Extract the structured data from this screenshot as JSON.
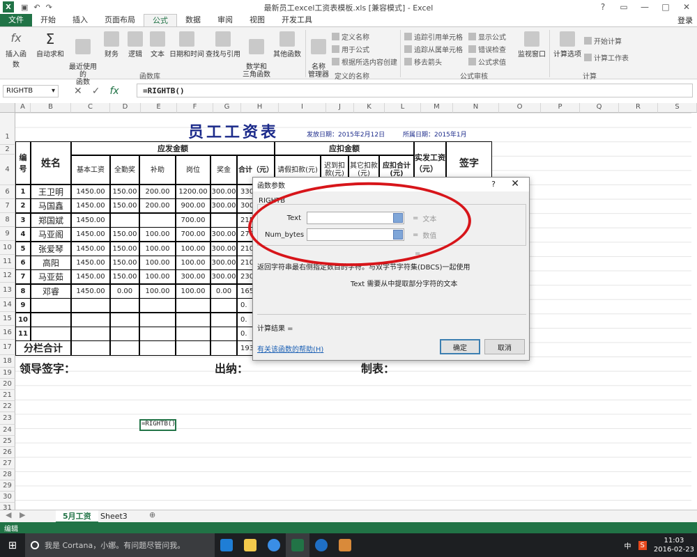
{
  "window": {
    "title": "最新员工excel工资表模板.xls  [兼容模式] - Excel",
    "controls": [
      "?",
      "▭",
      "—",
      "□",
      "✕"
    ]
  },
  "ribbon": {
    "tabs": [
      "文件",
      "开始",
      "插入",
      "页面布局",
      "公式",
      "数据",
      "审阅",
      "视图",
      "开发工具"
    ],
    "active_tab": "公式",
    "login": "登录",
    "buttons": {
      "insert_fn": "插入函数",
      "autosum": "自动求和",
      "recent": "最近使用的\n函数",
      "finance": "财务",
      "logic": "逻辑",
      "text": "文本",
      "datetime": "日期和时间",
      "lookup": "查找与引用",
      "math": "数学和\n三角函数",
      "other": "其他函数",
      "name_mgr": "名称\n管理器",
      "define_name": "定义名称",
      "use_in_formula": "用于公式",
      "create_from_sel": "根据所选内容创建",
      "trace_prec": "追踪引用单元格",
      "trace_dep": "追踪从属单元格",
      "remove_arrows": "移去箭头",
      "show_formulas": "显示公式",
      "error_check": "错误检查",
      "eval_formula": "公式求值",
      "watch": "监视窗口",
      "calc_options": "计算选项",
      "calc_now": "开始计算",
      "calc_sheet": "计算工作表"
    },
    "groups": [
      "函数库",
      "定义的名称",
      "公式审核",
      "计算"
    ]
  },
  "formula_bar": {
    "name_box": "RIGHTB",
    "formula": "=RIGHTB()"
  },
  "columns": [
    "A",
    "B",
    "C",
    "D",
    "E",
    "F",
    "G",
    "H",
    "I",
    "J",
    "K",
    "L",
    "M",
    "N",
    "O",
    "P",
    "Q",
    "R",
    "S"
  ],
  "rows": [
    "1",
    "2",
    "4",
    "6",
    "7",
    "8",
    "9",
    "10",
    "11",
    "12",
    "13",
    "14",
    "15",
    "16",
    "17",
    "18",
    "19",
    "20",
    "21",
    "22",
    "23",
    "24",
    "25",
    "26",
    "27",
    "28",
    "29",
    "30",
    "31"
  ],
  "sheet": {
    "title": "员工工资表",
    "issue_date": "发放日期：2015年2月12日",
    "period": "所属日期：2015年1月",
    "headers": {
      "no": "编\n号",
      "name": "姓名",
      "payable": "应发金额",
      "deduct": "应扣金额",
      "net": "实发工资\n（元）",
      "sign": "签字",
      "base": "基本工资",
      "attendance": "全勤奖",
      "subsidy": "补助",
      "position": "岗位",
      "bonus": "奖金",
      "total": "合计（元）",
      "leave": "请假扣款(元)",
      "late": "迟到扣\n款(元)",
      "other": "其它扣款\n(元)",
      "deduct_total": "应扣合计\n(元)"
    },
    "employees": [
      {
        "no": "1",
        "name": "王卫明",
        "base": "1450.00",
        "att": "150.00",
        "sub": "200.00",
        "pos": "1200.00",
        "bonus": "300.00",
        "total": "330"
      },
      {
        "no": "2",
        "name": "马国鑫",
        "base": "1450.00",
        "att": "150.00",
        "sub": "200.00",
        "pos": "900.00",
        "bonus": "300.00",
        "total": "300"
      },
      {
        "no": "3",
        "name": "郑国斌",
        "base": "1450.00",
        "att": "",
        "sub": "",
        "pos": "700.00",
        "bonus": "",
        "total": "215"
      },
      {
        "no": "4",
        "name": "马亚阁",
        "base": "1450.00",
        "att": "150.00",
        "sub": "100.00",
        "pos": "700.00",
        "bonus": "300.00",
        "total": "270"
      },
      {
        "no": "5",
        "name": "张爱琴",
        "base": "1450.00",
        "att": "150.00",
        "sub": "100.00",
        "pos": "100.00",
        "bonus": "300.00",
        "total": "210"
      },
      {
        "no": "6",
        "name": "高阳",
        "base": "1450.00",
        "att": "150.00",
        "sub": "100.00",
        "pos": "100.00",
        "bonus": "300.00",
        "total": "210"
      },
      {
        "no": "7",
        "name": "马亚茹",
        "base": "1450.00",
        "att": "150.00",
        "sub": "100.00",
        "pos": "300.00",
        "bonus": "300.00",
        "total": "230"
      },
      {
        "no": "8",
        "name": "邓睿",
        "base": "1450.00",
        "att": "0.00",
        "sub": "100.00",
        "pos": "100.00",
        "bonus": "0.00",
        "total": "165"
      },
      {
        "no": "9",
        "name": "",
        "base": "",
        "att": "",
        "sub": "",
        "pos": "",
        "bonus": "",
        "total": "0."
      },
      {
        "no": "10",
        "name": "",
        "base": "",
        "att": "",
        "sub": "",
        "pos": "",
        "bonus": "",
        "total": "0."
      },
      {
        "no": "11",
        "name": "",
        "base": "",
        "att": "",
        "sub": "",
        "pos": "",
        "bonus": "",
        "total": "0."
      }
    ],
    "subtotal_label": "分栏合计",
    "subtotal_value": "1930",
    "sig_leader": "领导签字：",
    "sig_cashier": "出纳：",
    "sig_maker": "制表：",
    "active_cell_text": "=RIGHTB()"
  },
  "dialog": {
    "title": "函数参数",
    "help_q": "?",
    "close": "✕",
    "function_name": "RIGHTB",
    "args": [
      {
        "label": "Text",
        "value": "文本"
      },
      {
        "label": "Num_bytes",
        "value": "数值"
      }
    ],
    "eq": "=",
    "description": "返回字符串最右侧指定数目的字符。与双字节字符集(DBCS)一起使用",
    "arg_desc": "Text  需要从中提取部分字符的文本",
    "result": "计算结果 =",
    "help_link": "有关该函数的帮助(H)",
    "ok": "确定",
    "cancel": "取消"
  },
  "sheet_tabs": [
    "5月工资",
    "Sheet3"
  ],
  "status": {
    "mode": "编辑"
  },
  "taskbar": {
    "cortana": "我是 Cortana，小娜。有问题尽管问我。",
    "ime": "中",
    "time": "11:03",
    "date": "2016-02-23"
  },
  "colors": {
    "excel_green": "#217346",
    "title_blue": "#1b2a8a",
    "annotation_red": "#d7151a"
  }
}
